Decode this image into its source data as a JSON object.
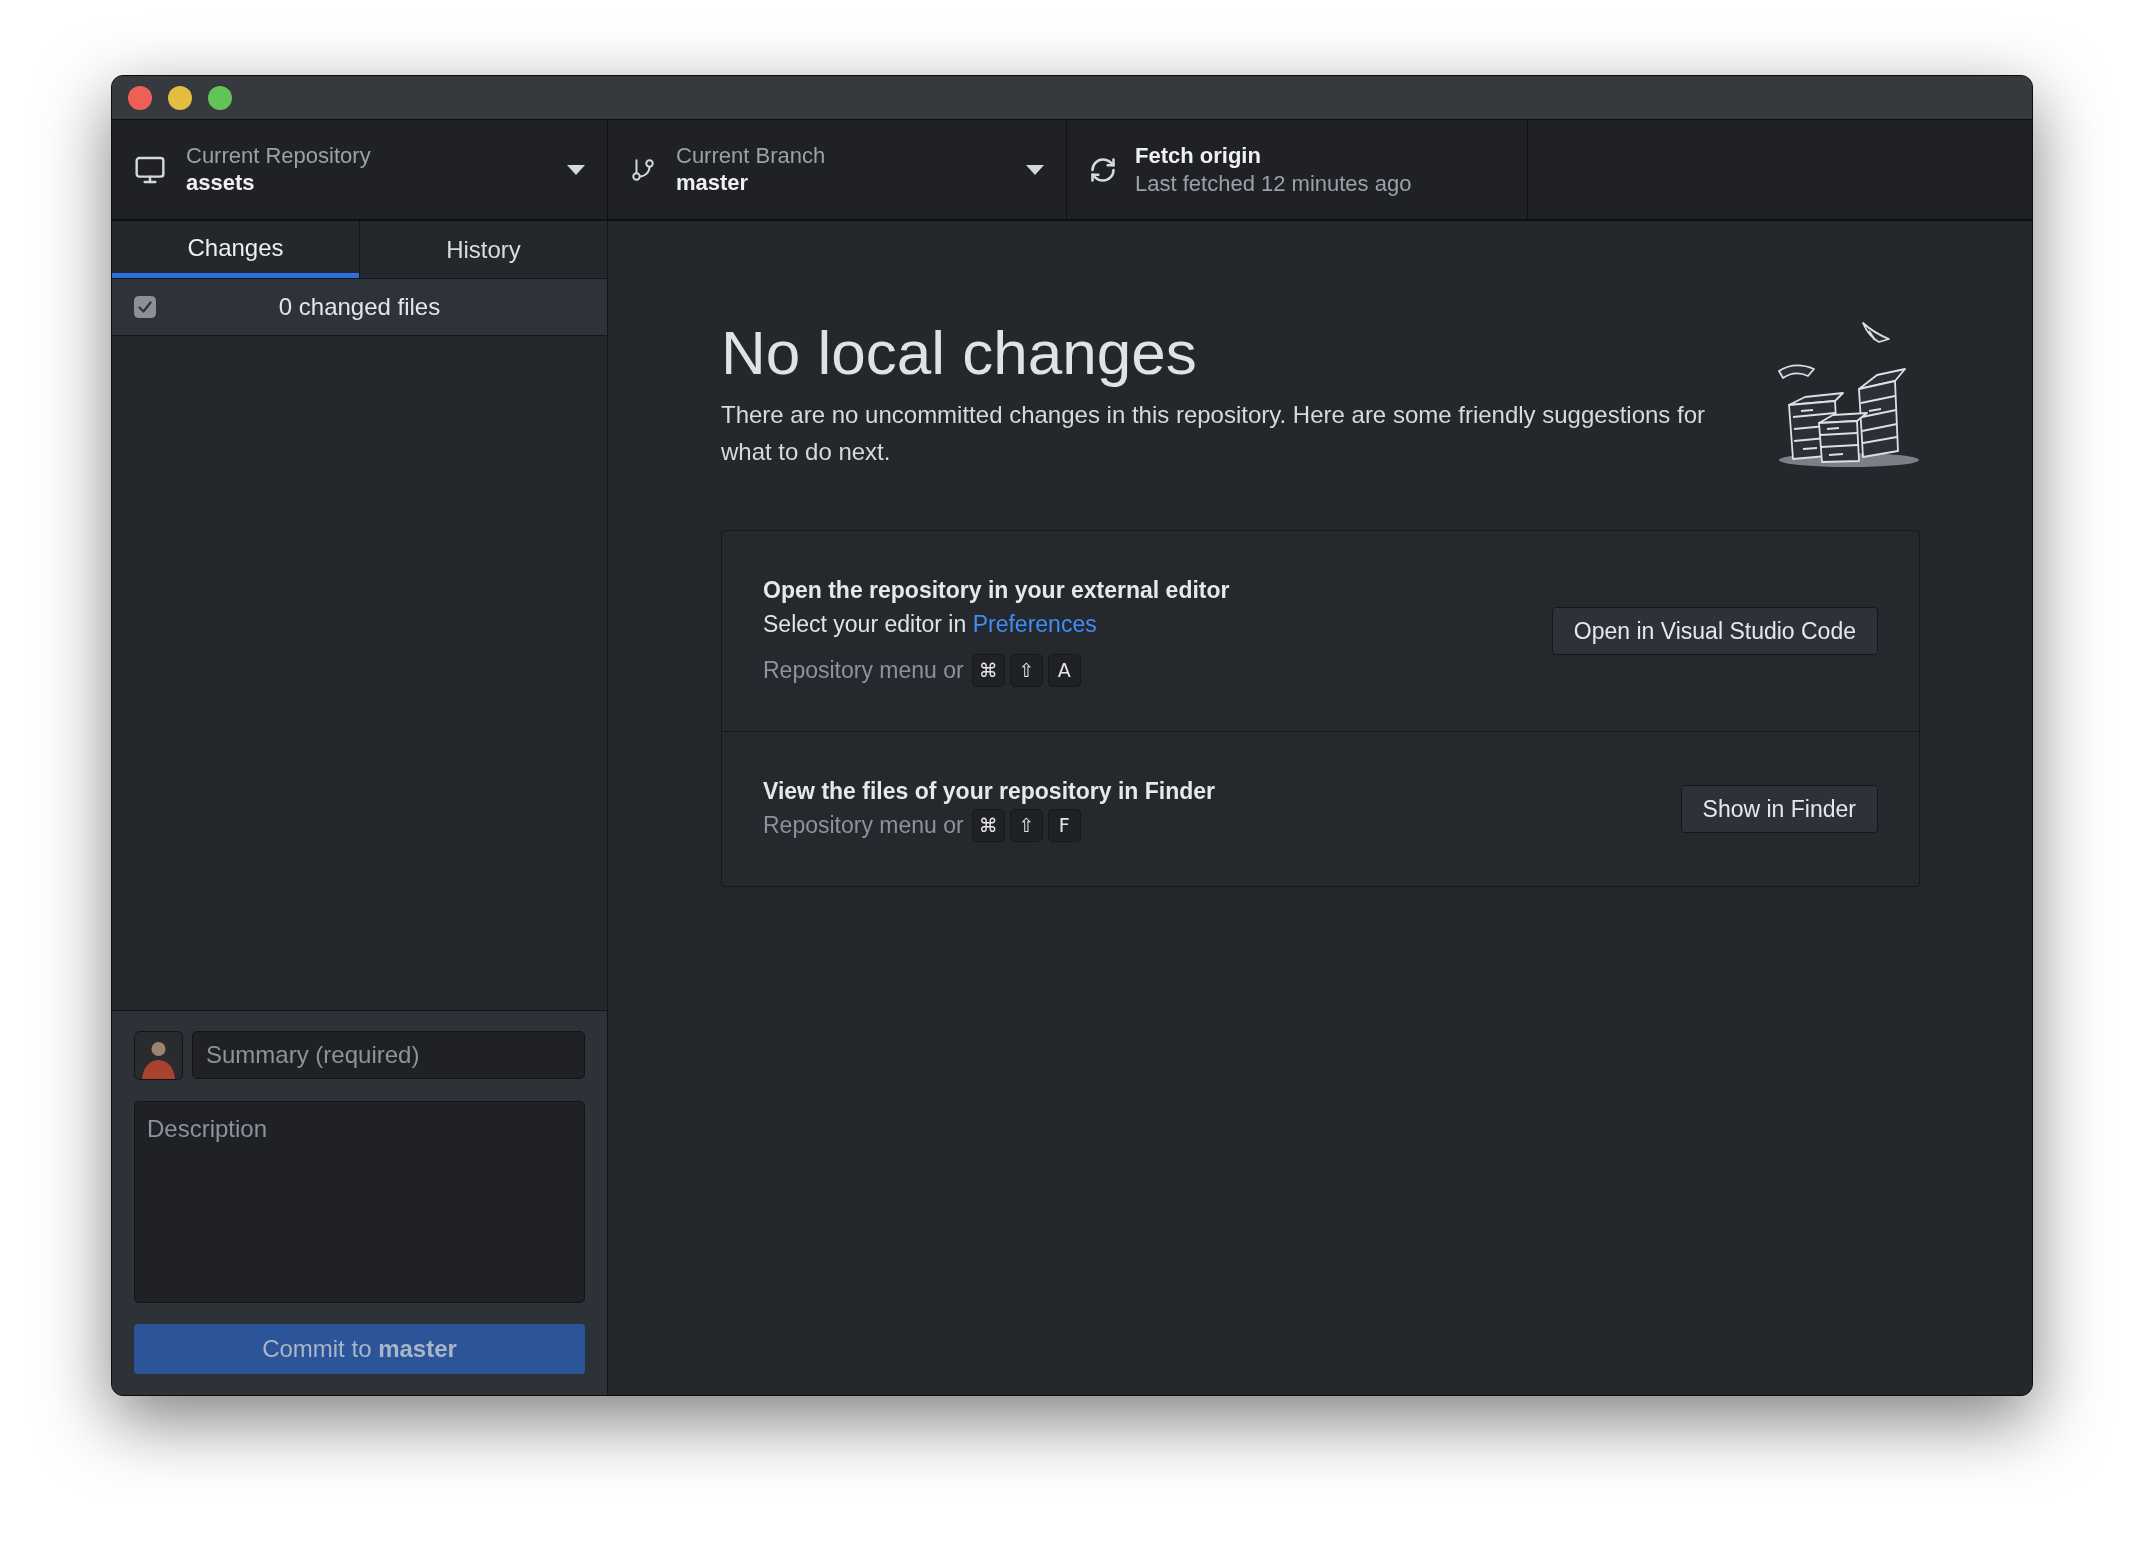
{
  "toolbar": {
    "repository": {
      "label": "Current Repository",
      "value": "assets"
    },
    "branch": {
      "label": "Current Branch",
      "value": "master"
    },
    "fetch": {
      "title": "Fetch origin",
      "subtitle": "Last fetched 12 minutes ago"
    }
  },
  "sidebar": {
    "tabs": [
      {
        "label": "Changes",
        "selected": true
      },
      {
        "label": "History",
        "selected": false
      }
    ],
    "changes_header": {
      "checked": true,
      "label": "0 changed files"
    },
    "commit": {
      "summary": {
        "placeholder": "Summary (required)"
      },
      "description": {
        "placeholder": "Description"
      },
      "button": {
        "label": "Commit to **master**",
        "disabled": true
      }
    }
  },
  "main": {
    "title": "No local changes",
    "message": "There are no uncommitted changes in this repository. Here are some friendly suggestions for what to do next.",
    "suggestions": [
      {
        "title": "Open the repository in your external editor",
        "description": {
          "text": "Select your editor in",
          "link": "Preferences"
        },
        "shortcut": {
          "prefix": "Repository menu or",
          "keys": [
            "⌘",
            "⇧",
            "A"
          ]
        },
        "button": "Open in Visual Studio Code"
      },
      {
        "title": "View the files of your repository in Finder",
        "shortcut": {
          "prefix": "Repository menu or",
          "keys": [
            "⌘",
            "⇧",
            "F"
          ]
        },
        "button": "Show in Finder"
      }
    ]
  }
}
